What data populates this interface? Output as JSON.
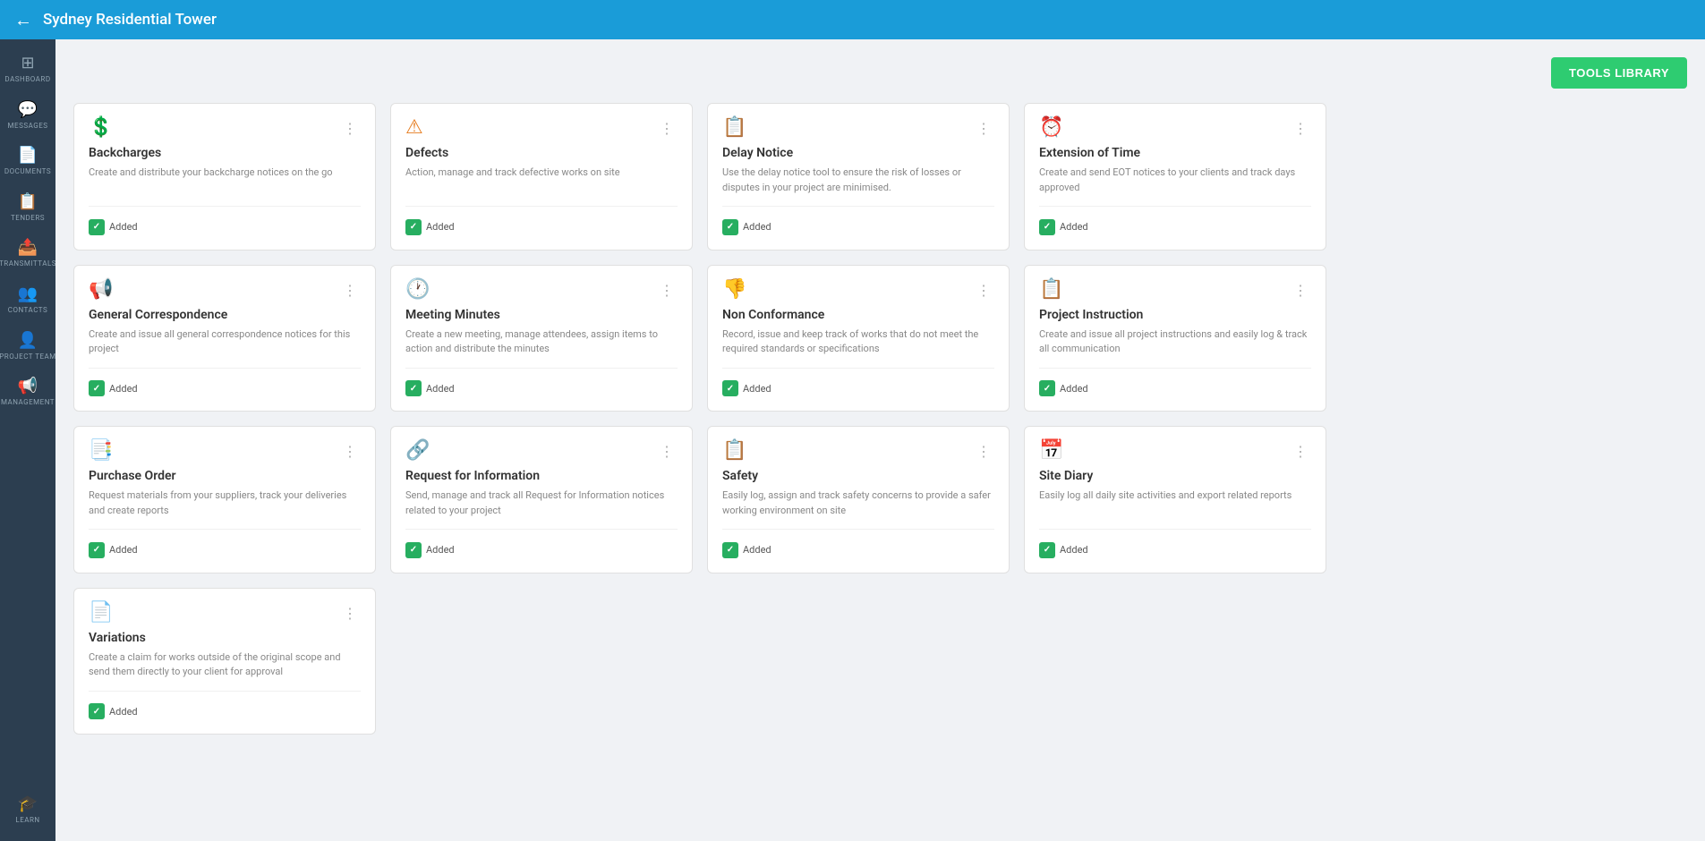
{
  "header": {
    "back_label": "←",
    "project_title": "Sydney Residential Tower"
  },
  "sidebar": {
    "items": [
      {
        "id": "dashboard",
        "label": "DASHBOARD",
        "icon": "⊞"
      },
      {
        "id": "messages",
        "label": "MESSAGES",
        "icon": "💬"
      },
      {
        "id": "documents",
        "label": "DOCUMENTS",
        "icon": "📄"
      },
      {
        "id": "tenders",
        "label": "TENDERS",
        "icon": "📋"
      },
      {
        "id": "transmittals",
        "label": "TRANSMITTALS",
        "icon": "📤"
      },
      {
        "id": "contacts",
        "label": "CONTACTS",
        "icon": "👥"
      },
      {
        "id": "project-team",
        "label": "PROJECT TEAM",
        "icon": "👤"
      },
      {
        "id": "management",
        "label": "MANAGEMENT",
        "icon": "📢"
      }
    ],
    "bottom_items": [
      {
        "id": "learn",
        "label": "LEARN",
        "icon": "🎓"
      }
    ]
  },
  "toolbar": {
    "tools_library_label": "TOOLS LIBRARY"
  },
  "cards": [
    {
      "id": "backcharges",
      "title": "Backcharges",
      "description": "Create and distribute your backcharge notices on the go",
      "icon": "💲",
      "icon_color": "icon-gray",
      "added": true,
      "added_label": "Added"
    },
    {
      "id": "defects",
      "title": "Defects",
      "description": "Action, manage and track defective works on site",
      "icon": "⚠",
      "icon_color": "icon-orange",
      "added": true,
      "added_label": "Added"
    },
    {
      "id": "delay-notice",
      "title": "Delay Notice",
      "description": "Use the delay notice tool to ensure the risk of losses or disputes in your project are minimised.",
      "icon": "📋",
      "icon_color": "icon-teal",
      "added": true,
      "added_label": "Added"
    },
    {
      "id": "extension-of-time",
      "title": "Extension of Time",
      "description": "Create and send EOT notices to your clients and track days approved",
      "icon": "⏰",
      "icon_color": "icon-yellow",
      "added": true,
      "added_label": "Added"
    },
    {
      "id": "general-correspondence",
      "title": "General Correspondence",
      "description": "Create and issue all general correspondence notices for this project",
      "icon": "📢",
      "icon_color": "icon-red",
      "added": true,
      "added_label": "Added"
    },
    {
      "id": "meeting-minutes",
      "title": "Meeting Minutes",
      "description": "Create a new meeting, manage attendees, assign items to action and distribute the minutes",
      "icon": "🕐",
      "icon_color": "icon-teal",
      "added": true,
      "added_label": "Added"
    },
    {
      "id": "non-conformance",
      "title": "Non Conformance",
      "description": "Record, issue and keep track of works that do not meet the required standards or specifications",
      "icon": "👎",
      "icon_color": "icon-yellow",
      "added": true,
      "added_label": "Added"
    },
    {
      "id": "project-instruction",
      "title": "Project Instruction",
      "description": "Create and issue all project instructions and easily log & track all communication",
      "icon": "📋",
      "icon_color": "icon-blue",
      "added": true,
      "added_label": "Added"
    },
    {
      "id": "purchase-order",
      "title": "Purchase Order",
      "description": "Request materials from your suppliers, track your deliveries and create reports",
      "icon": "📑",
      "icon_color": "icon-orange",
      "added": true,
      "added_label": "Added"
    },
    {
      "id": "request-for-information",
      "title": "Request for Information",
      "description": "Send, manage and track all Request for Information notices related to your project",
      "icon": "🔗",
      "icon_color": "icon-yellow",
      "added": true,
      "added_label": "Added"
    },
    {
      "id": "safety",
      "title": "Safety",
      "description": "Easily log, assign and track safety concerns to provide a safer working environment on site",
      "icon": "📋",
      "icon_color": "icon-purple",
      "added": true,
      "added_label": "Added"
    },
    {
      "id": "site-diary",
      "title": "Site Diary",
      "description": "Easily log all daily site activities and export related reports",
      "icon": "📅",
      "icon_color": "icon-cyan",
      "added": true,
      "added_label": "Added"
    },
    {
      "id": "variations",
      "title": "Variations",
      "description": "Create a claim for works outside of the original scope and send them directly to your client for approval",
      "icon": "📄",
      "icon_color": "icon-cyan",
      "added": true,
      "added_label": "Added"
    }
  ]
}
